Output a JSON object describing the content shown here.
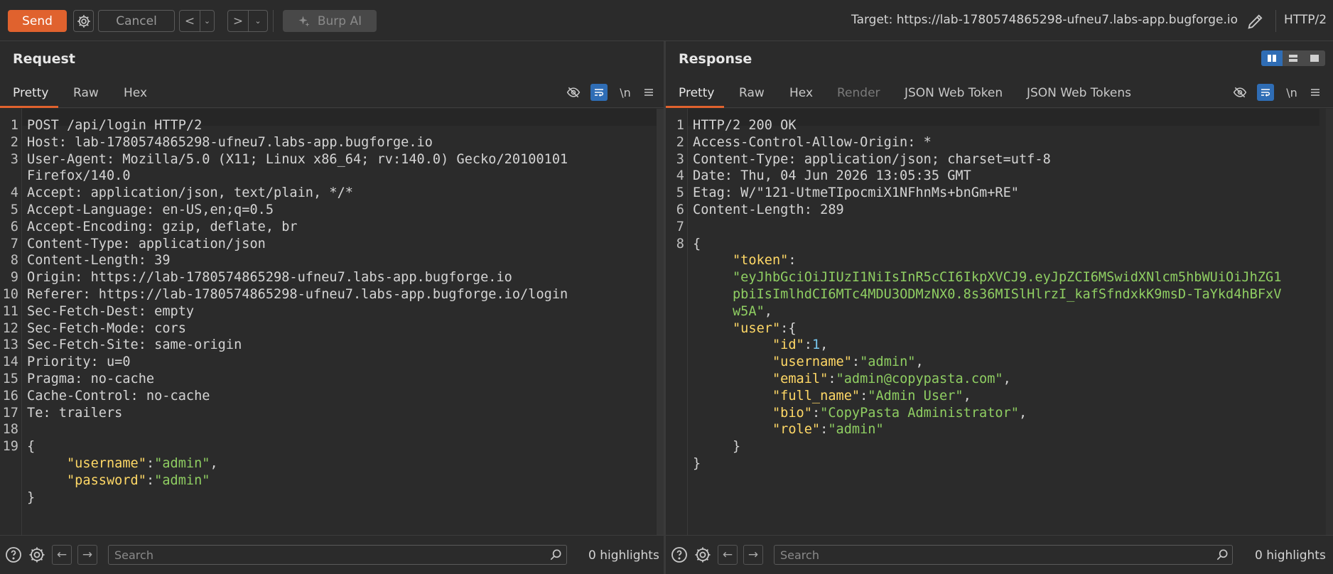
{
  "toolbar": {
    "send_label": "Send",
    "cancel_label": "Cancel",
    "prev_label": "<",
    "next_label": ">",
    "burp_ai_label": "Burp AI",
    "target_label": "Target: https://lab-1780574865298-ufneu7.labs-app.bugforge.io",
    "protocol_label": "HTTP/2"
  },
  "request": {
    "title": "Request",
    "tabs": [
      "Pretty",
      "Raw",
      "Hex"
    ],
    "newline_toggle": "\\n",
    "line_numbers": [
      "1",
      "2",
      "3",
      "",
      "4",
      "5",
      "6",
      "7",
      "8",
      "9",
      "10",
      "11",
      "12",
      "13",
      "14",
      "15",
      "16",
      "17",
      "18",
      "19",
      "",
      "",
      ""
    ],
    "lines": [
      [
        [
          "hk",
          "POST /api/login HTTP/2"
        ]
      ],
      [
        [
          "hk",
          "Host: "
        ],
        [
          "hv",
          "lab-1780574865298-ufneu7.labs-app.bugforge.io"
        ]
      ],
      [
        [
          "hk",
          "User-Agent: "
        ],
        [
          "hv",
          "Mozilla/5.0 (X11; Linux x86_64; rv:140.0) Gecko/20100101"
        ]
      ],
      [
        [
          "hv",
          "Firefox/140.0"
        ]
      ],
      [
        [
          "hk",
          "Accept: "
        ],
        [
          "hv",
          "application/json, text/plain, */*"
        ]
      ],
      [
        [
          "hk",
          "Accept-Language: "
        ],
        [
          "hv",
          "en-US,en;q=0.5"
        ]
      ],
      [
        [
          "hk",
          "Accept-Encoding: "
        ],
        [
          "hv",
          "gzip, deflate, br"
        ]
      ],
      [
        [
          "hk",
          "Content-Type: "
        ],
        [
          "hv",
          "application/json"
        ]
      ],
      [
        [
          "hk",
          "Content-Length: "
        ],
        [
          "hv",
          "39"
        ]
      ],
      [
        [
          "hk",
          "Origin: "
        ],
        [
          "hv",
          "https://lab-1780574865298-ufneu7.labs-app.bugforge.io"
        ]
      ],
      [
        [
          "hk",
          "Referer: "
        ],
        [
          "hv",
          "https://lab-1780574865298-ufneu7.labs-app.bugforge.io/login"
        ]
      ],
      [
        [
          "hk",
          "Sec-Fetch-Dest: "
        ],
        [
          "hv",
          "empty"
        ]
      ],
      [
        [
          "hk",
          "Sec-Fetch-Mode: "
        ],
        [
          "hv",
          "cors"
        ]
      ],
      [
        [
          "hk",
          "Sec-Fetch-Site: "
        ],
        [
          "hv",
          "same-origin"
        ]
      ],
      [
        [
          "hk",
          "Priority: "
        ],
        [
          "hv",
          "u=0"
        ]
      ],
      [
        [
          "hk",
          "Pragma: "
        ],
        [
          "hv",
          "no-cache"
        ]
      ],
      [
        [
          "hk",
          "Cache-Control: "
        ],
        [
          "hv",
          "no-cache"
        ]
      ],
      [
        [
          "hk",
          "Te: "
        ],
        [
          "hv",
          "trailers"
        ]
      ],
      [
        [
          "hv",
          ""
        ]
      ],
      [
        [
          "hv",
          "{"
        ]
      ],
      [
        [
          "hv",
          "     "
        ],
        [
          "k",
          "\"username\""
        ],
        [
          "hv",
          ":"
        ],
        [
          "s",
          "\"admin\""
        ],
        [
          "hv",
          ","
        ]
      ],
      [
        [
          "hv",
          "     "
        ],
        [
          "k",
          "\"password\""
        ],
        [
          "hv",
          ":"
        ],
        [
          "s",
          "\"admin\""
        ]
      ],
      [
        [
          "hv",
          "}"
        ]
      ]
    ],
    "search_placeholder": "Search",
    "highlights": "0 highlights"
  },
  "response": {
    "title": "Response",
    "tabs": [
      "Pretty",
      "Raw",
      "Hex",
      "Render",
      "JSON Web Token",
      "JSON Web Tokens"
    ],
    "newline_toggle": "\\n",
    "line_numbers": [
      "1",
      "2",
      "3",
      "4",
      "5",
      "6",
      "7",
      "8",
      "",
      "",
      "",
      "",
      "",
      "",
      "",
      "",
      "",
      "",
      "",
      "",
      ""
    ],
    "lines": [
      [
        [
          "hk",
          "HTTP/2 200 OK"
        ]
      ],
      [
        [
          "hk",
          "Access-Control-Allow-Origin: "
        ],
        [
          "hv",
          "*"
        ]
      ],
      [
        [
          "hk",
          "Content-Type: "
        ],
        [
          "hv",
          "application/json; charset=utf-8"
        ]
      ],
      [
        [
          "hk",
          "Date: "
        ],
        [
          "hv",
          "Thu, 04 Jun 2026 13:05:35 GMT"
        ]
      ],
      [
        [
          "hk",
          "Etag: "
        ],
        [
          "hv",
          "W/\"121-UtmeTIpocmiX1NFhnMs+bnGm+RE\""
        ]
      ],
      [
        [
          "hk",
          "Content-Length: "
        ],
        [
          "hv",
          "289"
        ]
      ],
      [
        [
          "hv",
          ""
        ]
      ],
      [
        [
          "hv",
          "{"
        ]
      ],
      [
        [
          "hv",
          "     "
        ],
        [
          "k",
          "\"token\""
        ],
        [
          "hv",
          ":"
        ]
      ],
      [
        [
          "hv",
          "     "
        ],
        [
          "s",
          "\"eyJhbGciOiJIUzI1NiIsInR5cCI6IkpXVCJ9.eyJpZCI6MSwidXNlcm5hbWUiOiJhZG1"
        ]
      ],
      [
        [
          "hv",
          "     "
        ],
        [
          "s",
          "pbiIsImlhdCI6MTc4MDU3ODMzNX0.8s36MISlHlrzI_kafSfndxkK9msD-TaYkd4hBFxV"
        ]
      ],
      [
        [
          "hv",
          "     "
        ],
        [
          "s",
          "w5A\""
        ],
        [
          "hv",
          ","
        ]
      ],
      [
        [
          "hv",
          "     "
        ],
        [
          "k",
          "\"user\""
        ],
        [
          "hv",
          ":{"
        ]
      ],
      [
        [
          "hv",
          "          "
        ],
        [
          "k",
          "\"id\""
        ],
        [
          "hv",
          ":"
        ],
        [
          "n",
          "1"
        ],
        [
          "hv",
          ","
        ]
      ],
      [
        [
          "hv",
          "          "
        ],
        [
          "k",
          "\"username\""
        ],
        [
          "hv",
          ":"
        ],
        [
          "s",
          "\"admin\""
        ],
        [
          "hv",
          ","
        ]
      ],
      [
        [
          "hv",
          "          "
        ],
        [
          "k",
          "\"email\""
        ],
        [
          "hv",
          ":"
        ],
        [
          "s",
          "\"admin@copypasta.com\""
        ],
        [
          "hv",
          ","
        ]
      ],
      [
        [
          "hv",
          "          "
        ],
        [
          "k",
          "\"full_name\""
        ],
        [
          "hv",
          ":"
        ],
        [
          "s",
          "\"Admin User\""
        ],
        [
          "hv",
          ","
        ]
      ],
      [
        [
          "hv",
          "          "
        ],
        [
          "k",
          "\"bio\""
        ],
        [
          "hv",
          ":"
        ],
        [
          "s",
          "\"CopyPasta Administrator\""
        ],
        [
          "hv",
          ","
        ]
      ],
      [
        [
          "hv",
          "          "
        ],
        [
          "k",
          "\"role\""
        ],
        [
          "hv",
          ":"
        ],
        [
          "s",
          "\"admin\""
        ]
      ],
      [
        [
          "hv",
          "     }"
        ]
      ],
      [
        [
          "hv",
          "}"
        ]
      ]
    ],
    "search_placeholder": "Search",
    "highlights": "0 highlights"
  },
  "colors": {
    "accent": "#e0622e",
    "selected_blue": "#2f6db5",
    "json_key": "#ffd866",
    "json_string": "#8fce62",
    "json_number": "#78c8f0"
  }
}
